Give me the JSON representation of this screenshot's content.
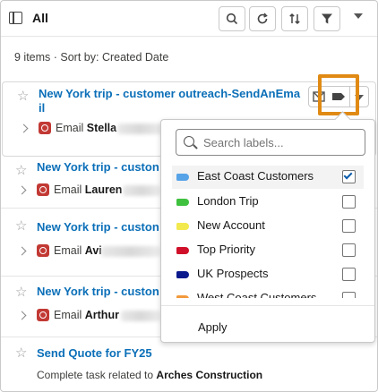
{
  "header": {
    "title": "All"
  },
  "subheader": "9 items · Sort by: Created Date",
  "items": [
    {
      "title_line1": "New York trip - customer outreach-SendAnEma",
      "title_line2": "il",
      "email_label": "Email",
      "email_name": "Stella"
    },
    {
      "title": "New York trip - custon",
      "email_label": "Email",
      "email_name": "Lauren"
    },
    {
      "title": "New York trip - custon",
      "email_label": "Email",
      "email_name": "Avi"
    },
    {
      "title": "New York trip - custon",
      "email_label": "Email",
      "email_name": "Arthur"
    },
    {
      "title": "Send Quote for FY25",
      "desc_prefix": "Complete task related to",
      "desc_bold": "Arches Construction"
    }
  ],
  "dropdown": {
    "search_placeholder": "Search labels...",
    "labels": [
      {
        "name": "East Coast Customers",
        "color": "#57a3e8",
        "checked": true
      },
      {
        "name": "London Trip",
        "color": "#3fc13f",
        "checked": false
      },
      {
        "name": "New Account",
        "color": "#f2e94e",
        "checked": false
      },
      {
        "name": "Top Priority",
        "color": "#d0102a",
        "checked": false
      },
      {
        "name": "UK Prospects",
        "color": "#0a1a8c",
        "checked": false
      },
      {
        "name": "West Coast Customers",
        "color": "#f29a3c",
        "checked": false
      }
    ],
    "apply_label": "Apply"
  },
  "colors": {
    "link": "#0b6fb8",
    "highlight": "#e08a14"
  },
  "icons": [
    "list-view-icon",
    "search-icon",
    "refresh-icon",
    "sort-icon",
    "filter-icon",
    "chevron-down-icon",
    "star-icon",
    "email-icon",
    "label-icon"
  ]
}
